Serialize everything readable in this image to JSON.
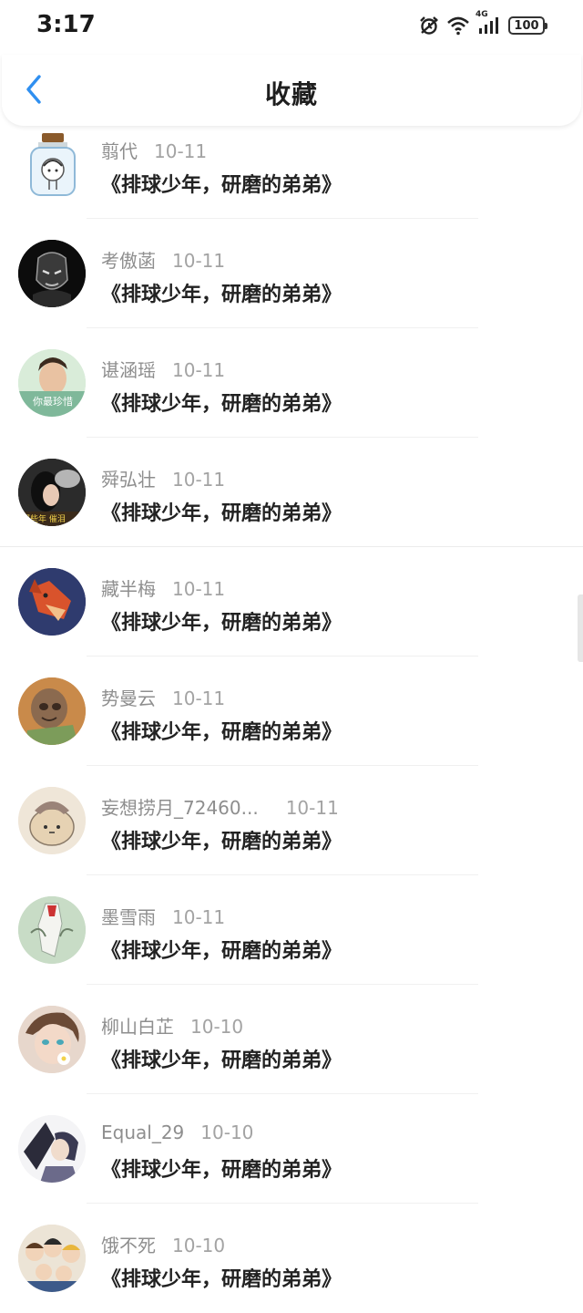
{
  "status_bar": {
    "time": "3:17",
    "network": "4G",
    "battery": "100",
    "icons": [
      "alarm-icon",
      "wifi-icon",
      "signal-icon",
      "battery-icon"
    ]
  },
  "header": {
    "title": "收藏",
    "back_icon": "chevron-left-icon",
    "accent_color": "#2f8ff0"
  },
  "items": [
    {
      "user": "翦代",
      "date": "10-11",
      "title": "《排球少年，研磨的弟弟》"
    },
    {
      "user": "考傲菡",
      "date": "10-11",
      "title": "《排球少年，研磨的弟弟》"
    },
    {
      "user": "谌涵瑶",
      "date": "10-11",
      "title": "《排球少年，研磨的弟弟》"
    },
    {
      "user": "舜弘壮",
      "date": "10-11",
      "title": "《排球少年，研磨的弟弟》"
    },
    {
      "user": "藏半梅",
      "date": "10-11",
      "title": "《排球少年，研磨的弟弟》"
    },
    {
      "user": "势曼云",
      "date": "10-11",
      "title": "《排球少年，研磨的弟弟》"
    },
    {
      "user": "妄想捞月_72460...",
      "date": "10-11",
      "title": "《排球少年，研磨的弟弟》"
    },
    {
      "user": "墨雪雨",
      "date": "10-11",
      "title": "《排球少年，研磨的弟弟》"
    },
    {
      "user": "柳山白芷",
      "date": "10-10",
      "title": "《排球少年，研磨的弟弟》"
    },
    {
      "user": "Equal_29",
      "date": "10-10",
      "title": "《排球少年，研磨的弟弟》"
    },
    {
      "user": "饿不死",
      "date": "10-10",
      "title": "《排球少年，研磨的弟弟》"
    }
  ]
}
